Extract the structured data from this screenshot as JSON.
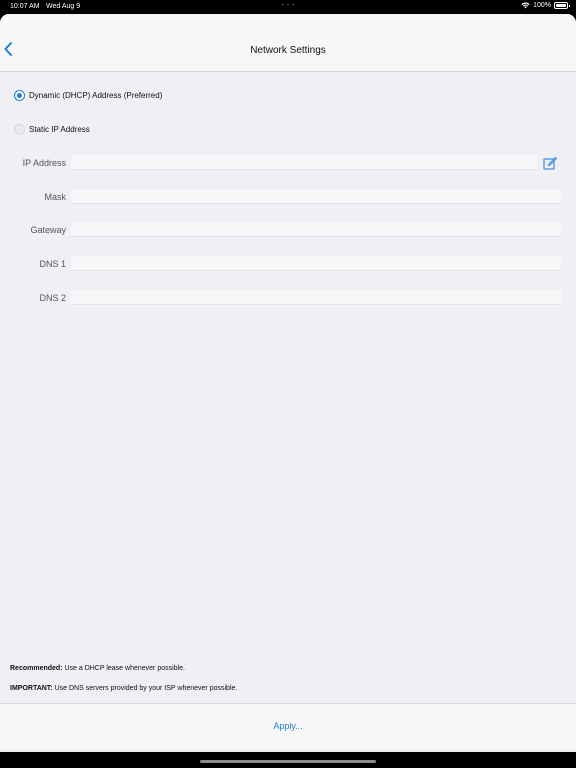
{
  "status_bar": {
    "time": "10:07 AM",
    "date": "Wed Aug 9",
    "battery": "100%",
    "icons": [
      "wifi-icon",
      "battery-icon"
    ],
    "battery_level": 1.0
  },
  "nav": {
    "title": "Network Settings",
    "back_icon": "chevron-left-icon"
  },
  "address_mode": {
    "options": [
      {
        "label": "Dynamic (DHCP) Address (Preferred)",
        "selected": true
      },
      {
        "label": "Static IP Address",
        "selected": false
      }
    ]
  },
  "fields": [
    {
      "label": "IP Address",
      "value": "",
      "placeholder": ""
    },
    {
      "label": "Mask",
      "value": "",
      "placeholder": ""
    },
    {
      "label": "Gateway",
      "value": "",
      "placeholder": ""
    },
    {
      "label": "DNS 1",
      "value": "",
      "placeholder": ""
    },
    {
      "label": "DNS 2",
      "value": "",
      "placeholder": ""
    }
  ],
  "edit_icon": "edit-icon",
  "notes": {
    "recommended_label": "Recommended:",
    "recommended_text": " Use a DHCP lease whenever possible.",
    "important_label": "IMPORTANT:",
    "important_text": " Use DNS servers provided by your ISP whenever possible."
  },
  "apply_label": "Apply...",
  "colors": {
    "accent": "#1a7ee0",
    "background": "#efeff4"
  }
}
